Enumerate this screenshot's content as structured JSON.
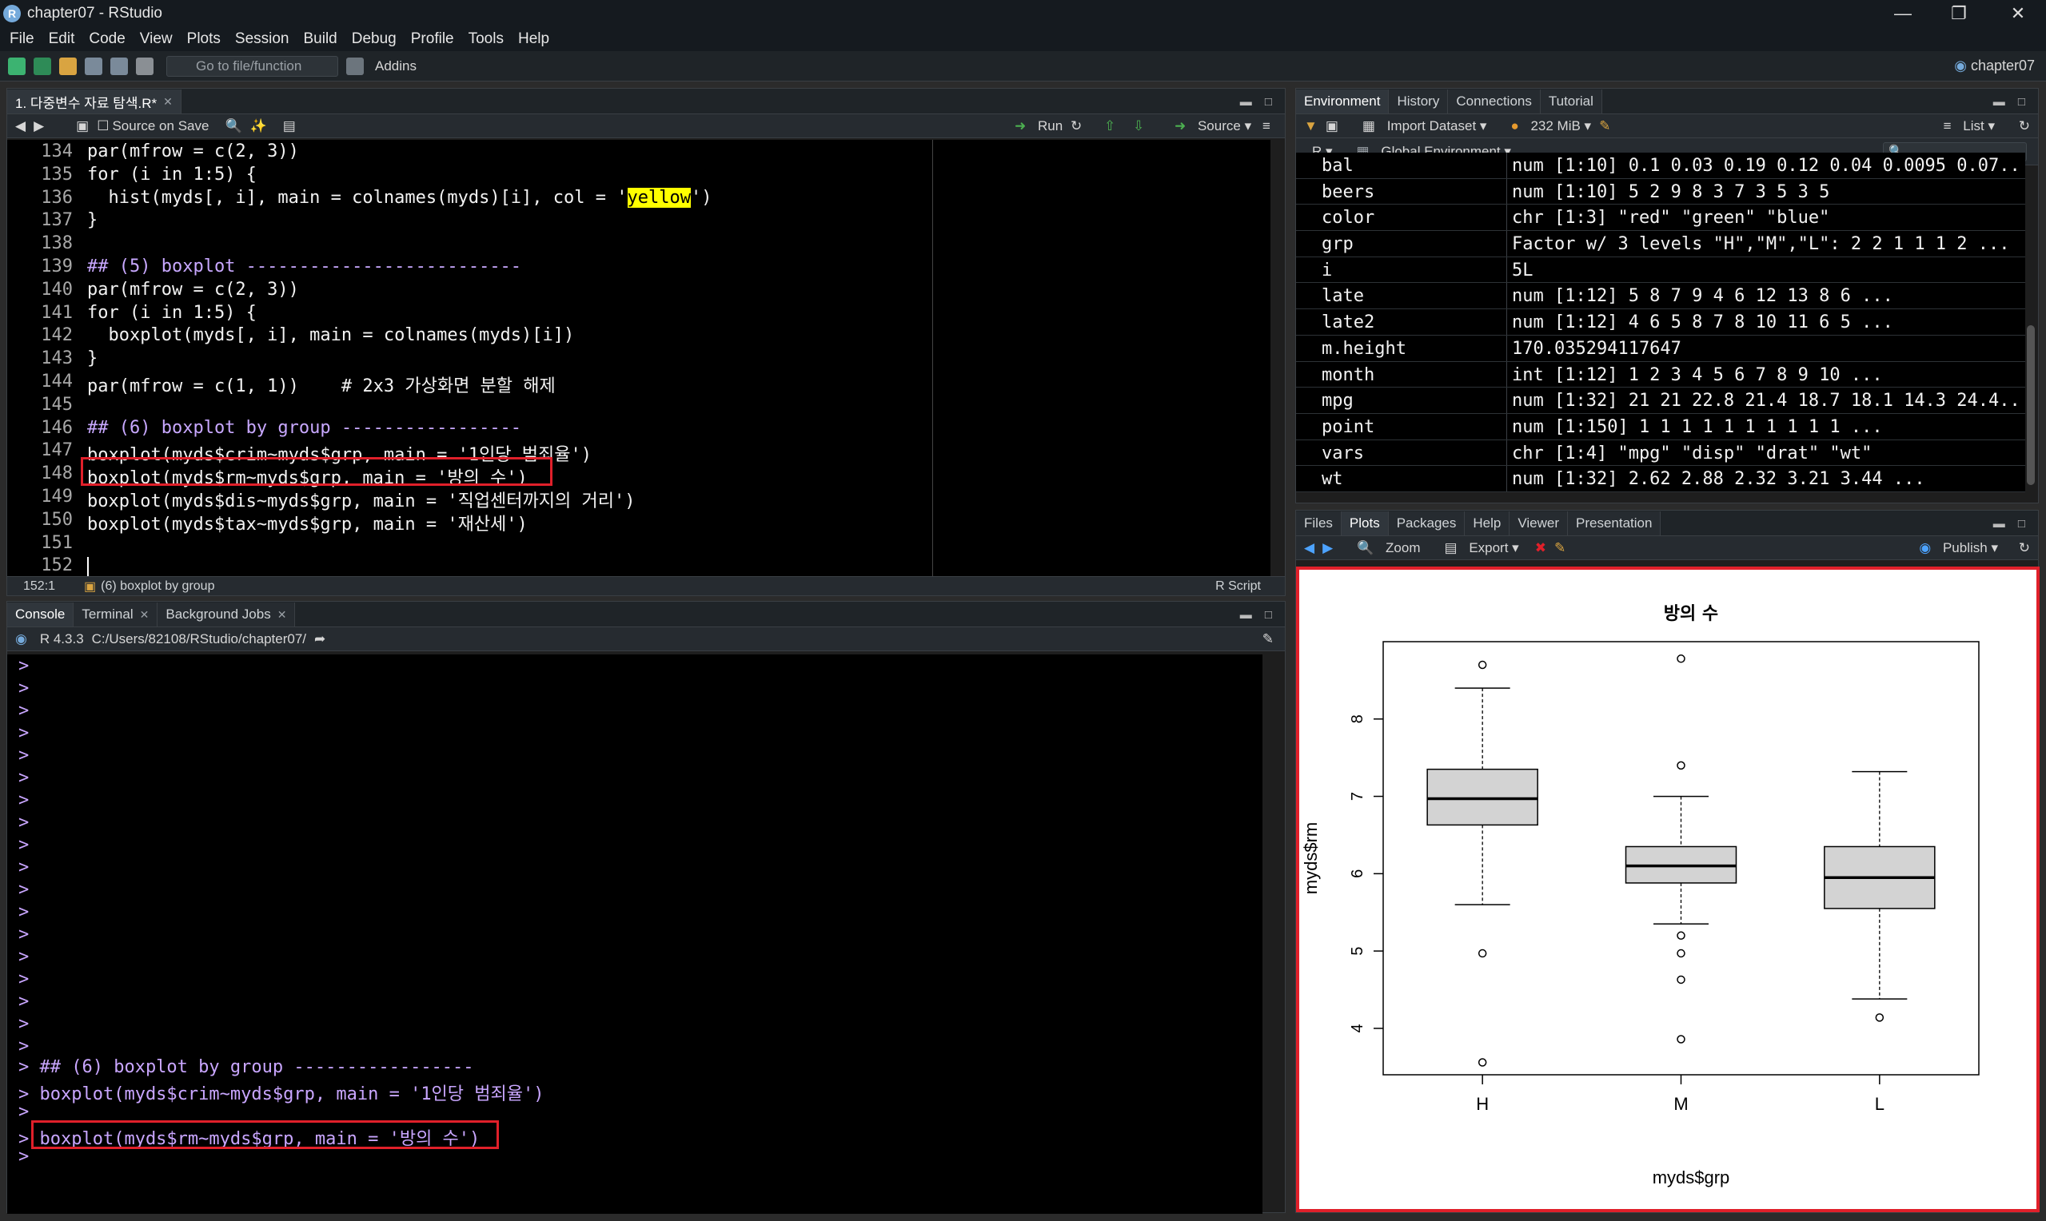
{
  "window": {
    "title": "chapter07 - RStudio",
    "logo_letter": "R"
  },
  "menu": [
    "File",
    "Edit",
    "Code",
    "View",
    "Plots",
    "Session",
    "Build",
    "Debug",
    "Profile",
    "Tools",
    "Help"
  ],
  "toolbar": {
    "goto_placeholder": "Go to file/function",
    "addins": "Addins",
    "project": "chapter07"
  },
  "editor": {
    "tab": "1. 다중변수 자료 탐색.R*",
    "source_on_save": "Source on Save",
    "run": "Run",
    "source": "Source",
    "status_pos": "152:1",
    "status_section": "(6) boxplot by group",
    "status_type": "R Script",
    "lines": [
      {
        "n": "134",
        "t": "par(mfrow = c(2, 3))"
      },
      {
        "n": "135",
        "t": "for (i in 1:5) {"
      },
      {
        "n": "136",
        "a": "  hist(myds[, i], main = colnames(myds)[i], col = '",
        "h": "yellow",
        "b": "')"
      },
      {
        "n": "137",
        "t": "}"
      },
      {
        "n": "138",
        "t": ""
      },
      {
        "n": "139",
        "c": "## (5) boxplot --------------------------"
      },
      {
        "n": "140",
        "t": "par(mfrow = c(2, 3))"
      },
      {
        "n": "141",
        "t": "for (i in 1:5) {"
      },
      {
        "n": "142",
        "t": "  boxplot(myds[, i], main = colnames(myds)[i])"
      },
      {
        "n": "143",
        "t": "}"
      },
      {
        "n": "144",
        "t": "par(mfrow = c(1, 1))    # 2x3 가상화면 분할 해제"
      },
      {
        "n": "145",
        "t": ""
      },
      {
        "n": "146",
        "c": "## (6) boxplot by group -----------------"
      },
      {
        "n": "147",
        "t": "boxplot(myds$crim~myds$grp, main = '1인당 범죄율')"
      },
      {
        "n": "148",
        "t": "boxplot(myds$rm~myds$grp, main = '방의 수')"
      },
      {
        "n": "149",
        "t": "boxplot(myds$dis~myds$grp, main = '직업센터까지의 거리')"
      },
      {
        "n": "150",
        "t": "boxplot(myds$tax~myds$grp, main = '재산세')"
      },
      {
        "n": "151",
        "t": ""
      },
      {
        "n": "152",
        "t": ""
      }
    ]
  },
  "console": {
    "tabs": [
      "Console",
      "Terminal",
      "Background Jobs"
    ],
    "version": "R 4.3.3",
    "path": "C:/Users/82108/RStudio/chapter07/",
    "last_lines": [
      "> ## (6) boxplot by group -----------------",
      "> boxplot(myds$crim~myds$grp, main = '1인당 범죄율')",
      ">",
      "> boxplot(myds$rm~myds$grp, main = '방의 수')",
      ">"
    ]
  },
  "environment": {
    "tabs": [
      "Environment",
      "History",
      "Connections",
      "Tutorial"
    ],
    "import_dataset": "Import Dataset",
    "memory": "232 MiB",
    "list_view": "List",
    "lang": "R",
    "scope": "Global Environment",
    "vars": [
      {
        "name": "bal",
        "value": "num [1:10] 0.1 0.03 0.19 0.12 0.04 0.0095 0.07..."
      },
      {
        "name": "beers",
        "value": "num [1:10] 5 2 9 8 3 7 3 5 3 5"
      },
      {
        "name": "color",
        "value": "chr [1:3] \"red\" \"green\" \"blue\""
      },
      {
        "name": "grp",
        "value": "Factor w/ 3 levels \"H\",\"M\",\"L\": 2 2 1 1 1 2 ..."
      },
      {
        "name": "i",
        "value": "5L"
      },
      {
        "name": "late",
        "value": "num [1:12] 5 8 7 9 4 6 12 13 8 6 ..."
      },
      {
        "name": "late2",
        "value": "num [1:12] 4 6 5 8 7 8 10 11 6 5 ..."
      },
      {
        "name": "m.height",
        "value": "170.035294117647"
      },
      {
        "name": "month",
        "value": "int [1:12] 1 2 3 4 5 6 7 8 9 10 ..."
      },
      {
        "name": "mpg",
        "value": "num [1:32] 21 21 22.8 21.4 18.7 18.1 14.3 24.4..."
      },
      {
        "name": "point",
        "value": "num [1:150] 1 1 1 1 1 1 1 1 1 1 ..."
      },
      {
        "name": "vars",
        "value": "chr [1:4] \"mpg\" \"disp\" \"drat\" \"wt\""
      },
      {
        "name": "wt",
        "value": "num [1:32] 2.62 2.88 2.32 3.21 3.44 ..."
      }
    ]
  },
  "plots": {
    "tabs": [
      "Files",
      "Plots",
      "Packages",
      "Help",
      "Viewer",
      "Presentation"
    ],
    "zoom": "Zoom",
    "export": "Export",
    "publish": "Publish"
  },
  "chart_data": {
    "type": "boxplot",
    "title": "방의 수",
    "xlabel": "myds$grp",
    "ylabel": "myds$rm",
    "ylim": [
      3.4,
      9.0
    ],
    "yticks": [
      4,
      5,
      6,
      7,
      8
    ],
    "categories": [
      "H",
      "M",
      "L"
    ],
    "boxes": [
      {
        "name": "H",
        "min": 5.6,
        "q1": 6.63,
        "median": 6.97,
        "q3": 7.35,
        "max": 8.4,
        "outliers": [
          8.7,
          4.97,
          3.56
        ]
      },
      {
        "name": "M",
        "min": 5.35,
        "q1": 5.88,
        "median": 6.1,
        "q3": 6.35,
        "max": 7.0,
        "outliers": [
          8.78,
          7.4,
          5.2,
          4.97,
          4.63,
          3.86
        ]
      },
      {
        "name": "L",
        "min": 4.38,
        "q1": 5.55,
        "median": 5.95,
        "q3": 6.35,
        "max": 7.32,
        "outliers": [
          4.14
        ]
      }
    ]
  }
}
